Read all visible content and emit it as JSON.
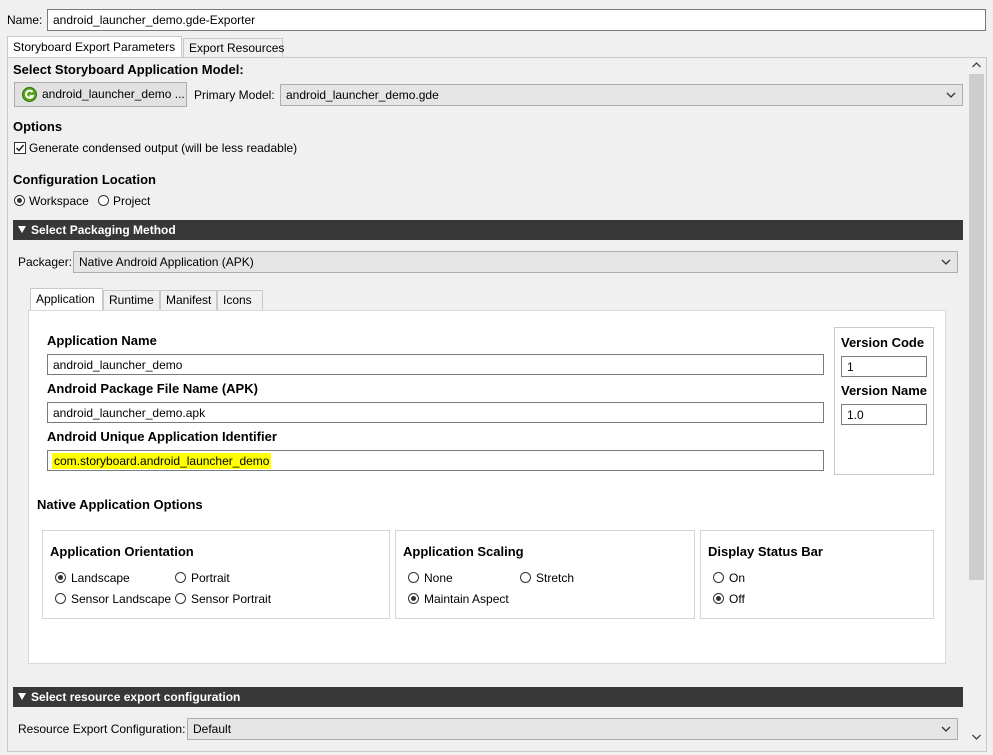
{
  "name_label": "Name:",
  "name_value": "android_launcher_demo.gde-Exporter",
  "top_tabs": [
    "Storyboard Export Parameters",
    "Export Resources"
  ],
  "select_model": {
    "heading": "Select Storyboard Application Model:",
    "model_button_label": "android_launcher_demo ...",
    "primary_model_label": "Primary Model:",
    "primary_model_value": "android_launcher_demo.gde"
  },
  "options": {
    "heading": "Options",
    "condensed_label": "Generate condensed output (will be less readable)",
    "condensed_checked": true
  },
  "config_location": {
    "heading": "Configuration Location",
    "workspace_label": "Workspace",
    "project_label": "Project",
    "selected": "Workspace"
  },
  "packaging": {
    "section_title": "Select Packaging Method",
    "packager_label": "Packager:",
    "packager_value": "Native Android Application (APK)"
  },
  "inner_tabs": [
    "Application",
    "Runtime",
    "Manifest",
    "Icons"
  ],
  "app": {
    "name_heading": "Application Name",
    "name_value": "android_launcher_demo",
    "apk_heading": "Android Package File Name (APK)",
    "apk_value": "android_launcher_demo.apk",
    "id_heading": "Android Unique Application Identifier",
    "id_value": "com.storyboard.android_launcher_demo",
    "version_code_heading": "Version Code",
    "version_code_value": "1",
    "version_name_heading": "Version Name",
    "version_name_value": "1.0"
  },
  "native_options": {
    "heading": "Native Application Options",
    "orientation": {
      "heading": "Application Orientation",
      "landscape": "Landscape",
      "portrait": "Portrait",
      "sensor_landscape": "Sensor Landscape",
      "sensor_portrait": "Sensor Portrait",
      "selected": "Landscape"
    },
    "scaling": {
      "heading": "Application Scaling",
      "none": "None",
      "stretch": "Stretch",
      "maintain_aspect": "Maintain Aspect",
      "selected": "Maintain Aspect"
    },
    "status_bar": {
      "heading": "Display Status Bar",
      "on": "On",
      "off": "Off",
      "selected": "Off"
    }
  },
  "resource_export": {
    "section_title": "Select resource export configuration",
    "label": "Resource Export Configuration:",
    "value": "Default"
  },
  "colors": {
    "section_bar": "#383838",
    "highlight": "#ffff00",
    "gde_icon": "#5aa51e"
  }
}
